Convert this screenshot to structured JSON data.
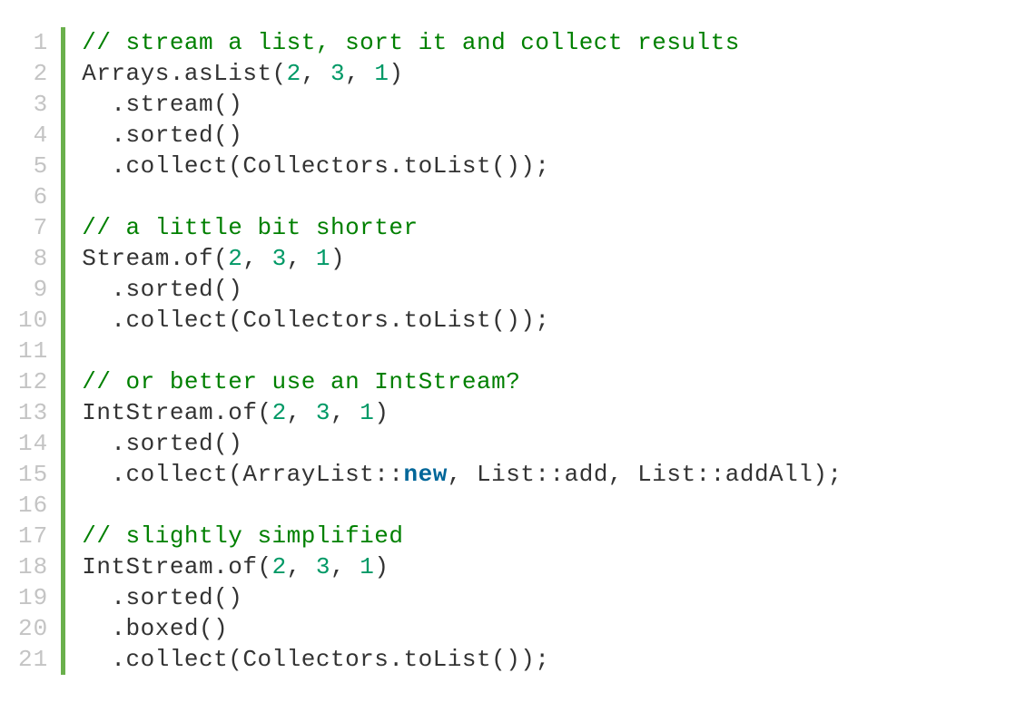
{
  "code": {
    "lineCount": 21,
    "lines": [
      [
        {
          "t": "comment",
          "s": "// stream a list, sort it and collect results"
        }
      ],
      [
        {
          "t": "default",
          "s": "Arrays.asList("
        },
        {
          "t": "number",
          "s": "2"
        },
        {
          "t": "default",
          "s": ", "
        },
        {
          "t": "number",
          "s": "3"
        },
        {
          "t": "default",
          "s": ", "
        },
        {
          "t": "number",
          "s": "1"
        },
        {
          "t": "default",
          "s": ")"
        }
      ],
      [
        {
          "t": "default",
          "s": "  .stream()"
        }
      ],
      [
        {
          "t": "default",
          "s": "  .sorted()"
        }
      ],
      [
        {
          "t": "default",
          "s": "  .collect(Collectors.toList());"
        }
      ],
      [],
      [
        {
          "t": "comment",
          "s": "// a little bit shorter"
        }
      ],
      [
        {
          "t": "default",
          "s": "Stream.of("
        },
        {
          "t": "number",
          "s": "2"
        },
        {
          "t": "default",
          "s": ", "
        },
        {
          "t": "number",
          "s": "3"
        },
        {
          "t": "default",
          "s": ", "
        },
        {
          "t": "number",
          "s": "1"
        },
        {
          "t": "default",
          "s": ")"
        }
      ],
      [
        {
          "t": "default",
          "s": "  .sorted()"
        }
      ],
      [
        {
          "t": "default",
          "s": "  .collect(Collectors.toList());"
        }
      ],
      [],
      [
        {
          "t": "comment",
          "s": "// or better use an IntStream?"
        }
      ],
      [
        {
          "t": "default",
          "s": "IntStream.of("
        },
        {
          "t": "number",
          "s": "2"
        },
        {
          "t": "default",
          "s": ", "
        },
        {
          "t": "number",
          "s": "3"
        },
        {
          "t": "default",
          "s": ", "
        },
        {
          "t": "number",
          "s": "1"
        },
        {
          "t": "default",
          "s": ")"
        }
      ],
      [
        {
          "t": "default",
          "s": "  .sorted()"
        }
      ],
      [
        {
          "t": "default",
          "s": "  .collect(ArrayList::"
        },
        {
          "t": "keyword",
          "s": "new"
        },
        {
          "t": "default",
          "s": ", List::add, List::addAll);"
        }
      ],
      [],
      [
        {
          "t": "comment",
          "s": "// slightly simplified"
        }
      ],
      [
        {
          "t": "default",
          "s": "IntStream.of("
        },
        {
          "t": "number",
          "s": "2"
        },
        {
          "t": "default",
          "s": ", "
        },
        {
          "t": "number",
          "s": "3"
        },
        {
          "t": "default",
          "s": ", "
        },
        {
          "t": "number",
          "s": "1"
        },
        {
          "t": "default",
          "s": ")"
        }
      ],
      [
        {
          "t": "default",
          "s": "  .sorted()"
        }
      ],
      [
        {
          "t": "default",
          "s": "  .boxed()"
        }
      ],
      [
        {
          "t": "default",
          "s": "  .collect(Collectors.toList());"
        }
      ]
    ]
  }
}
